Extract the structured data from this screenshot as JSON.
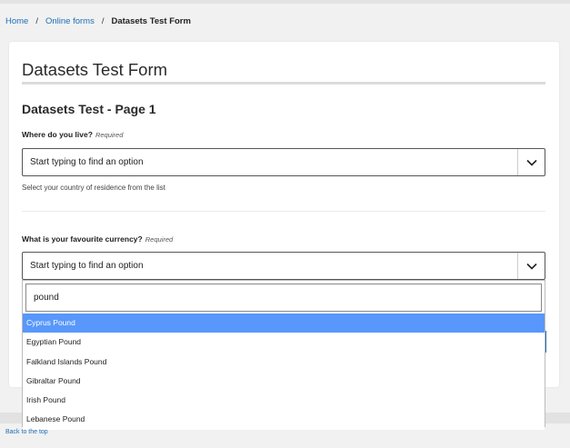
{
  "breadcrumb": {
    "home": "Home",
    "sep1": "/",
    "online_forms": "Online forms",
    "sep2": "/",
    "current": "Datasets Test Form"
  },
  "form": {
    "title": "Datasets Test Form",
    "page_title": "Datasets Test - Page 1"
  },
  "q1": {
    "label": "Where do you live?",
    "required": "Required",
    "placeholder": "Start typing to find an option",
    "hint": "Select your country of residence from the list",
    "chevron": "chevron-down-icon"
  },
  "q2": {
    "label": "What is your favourite currency?",
    "required": "Required",
    "placeholder": "Start typing to find an option",
    "chevron": "chevron-down-icon"
  },
  "dropdown": {
    "search_value": "pound",
    "options": [
      "Cyprus Pound",
      "Egyptian Pound",
      "Falkland Islands Pound",
      "Gibraltar Pound",
      "Irish Pound",
      "Lebanese Pound"
    ],
    "highlighted_index": 0
  },
  "footer": {
    "back_to_top": "Back to the top"
  },
  "colors": {
    "link": "#1d6fb8",
    "highlight": "#5897fb"
  }
}
